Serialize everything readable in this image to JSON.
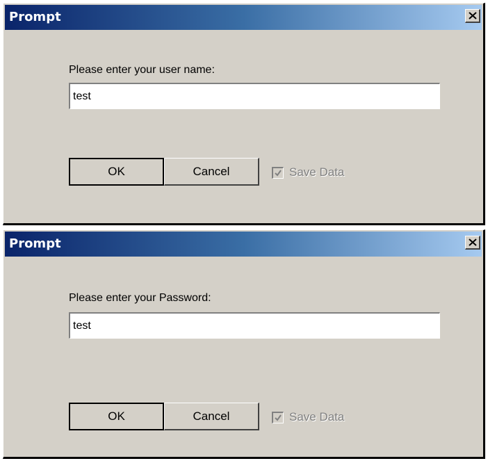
{
  "dialogs": [
    {
      "title": "Prompt",
      "prompt": "Please enter your user name:",
      "input_value": "test",
      "ok_label": "OK",
      "cancel_label": "Cancel",
      "save_label": "Save Data",
      "save_checked": true,
      "save_disabled": true
    },
    {
      "title": "Prompt",
      "prompt": "Please enter your Password:",
      "input_value": "test",
      "ok_label": "OK",
      "cancel_label": "Cancel",
      "save_label": "Save Data",
      "save_checked": true,
      "save_disabled": true
    }
  ],
  "icons": {
    "close": "close-icon",
    "check": "checkmark-icon"
  },
  "colors": {
    "dialog_bg": "#d4d0c8",
    "title_start": "#0a246a",
    "title_end": "#a6caf0",
    "disabled_text": "#808080"
  }
}
